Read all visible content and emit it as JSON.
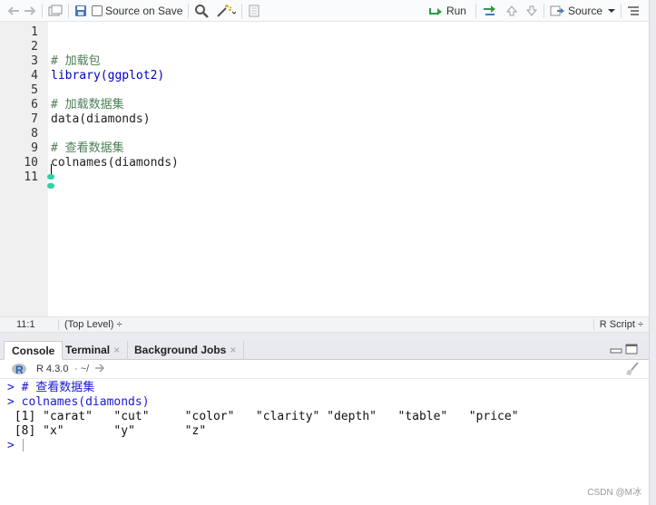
{
  "toolbar": {
    "source_on_save_label": "Source on Save",
    "run_label": "Run",
    "source_label": "Source"
  },
  "editor": {
    "lines": [
      {
        "num": "1",
        "text": "",
        "kind": "plain"
      },
      {
        "num": "2",
        "text": "",
        "kind": "plain"
      },
      {
        "num": "3",
        "text": "# 加载包",
        "kind": "comment"
      },
      {
        "num": "4",
        "text": "library(ggplot2)",
        "kind": "fn"
      },
      {
        "num": "5",
        "text": "",
        "kind": "plain"
      },
      {
        "num": "6",
        "text": "# 加载数据集",
        "kind": "comment"
      },
      {
        "num": "7",
        "text": "data(diamonds)",
        "kind": "plain"
      },
      {
        "num": "8",
        "text": "",
        "kind": "plain"
      },
      {
        "num": "9",
        "text": "# 查看数据集",
        "kind": "comment"
      },
      {
        "num": "10",
        "text": "colnames(diamonds)",
        "kind": "plain"
      },
      {
        "num": "11",
        "text": "",
        "kind": "plain"
      }
    ]
  },
  "statusbar": {
    "position": "11:1",
    "scope": "(Top Level) ÷",
    "file_type": "R Script ÷"
  },
  "console": {
    "tabs": [
      {
        "label": "Console",
        "closable": false
      },
      {
        "label": "Terminal",
        "closable": true
      },
      {
        "label": "Background Jobs",
        "closable": true
      }
    ],
    "r_version": "R 4.3.0",
    "path": "· ~/",
    "lines": [
      {
        "text": "> # 查看数据集",
        "kind": "input"
      },
      {
        "text": "> colnames(diamonds)",
        "kind": "input"
      },
      {
        "text": " [1] \"carat\"   \"cut\"     \"color\"   \"clarity\" \"depth\"   \"table\"   \"price\"",
        "kind": "out"
      },
      {
        "text": " [8] \"x\"       \"y\"       \"z\"",
        "kind": "out"
      },
      {
        "text": ">",
        "kind": "input"
      }
    ]
  },
  "watermark": "CSDN @M冰",
  "colors": {
    "comment": "#4d8058",
    "function": "#0000c8",
    "console_input": "#1a1ad6",
    "r_logo": "#2266b8",
    "marker": "#2bd3a6"
  }
}
